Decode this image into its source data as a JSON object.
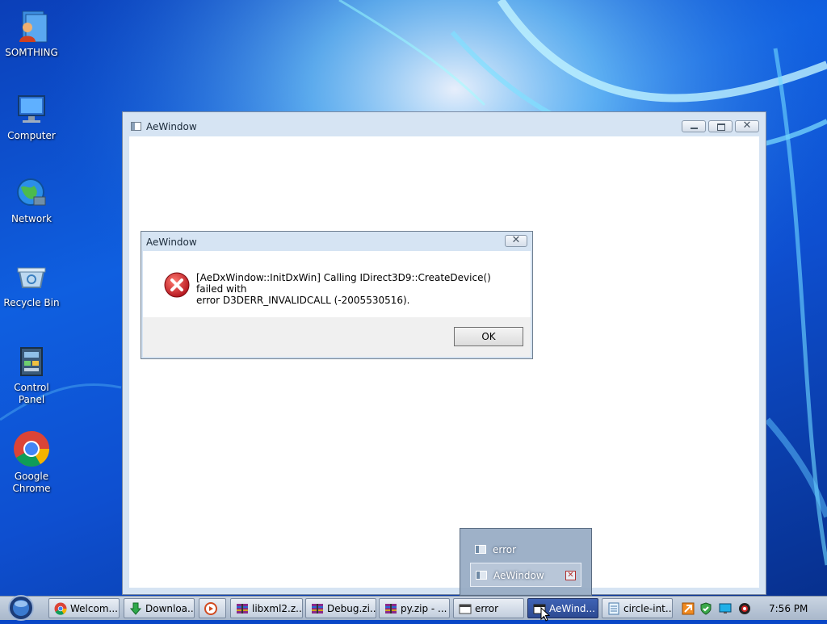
{
  "desktop": {
    "icons": [
      {
        "label": "SOMTHING",
        "icon": "user-folder-icon"
      },
      {
        "label": "Computer",
        "icon": "computer-icon"
      },
      {
        "label": "Network",
        "icon": "network-globe-icon"
      },
      {
        "label": "Recycle Bin",
        "icon": "recycle-bin-icon"
      },
      {
        "label": "Control Panel",
        "icon": "control-panel-icon"
      },
      {
        "label": "Google Chrome",
        "icon": "chrome-icon"
      }
    ]
  },
  "main_window": {
    "title": "AeWindow",
    "buttons": {
      "minimize": "minimize",
      "maximize": "maximize",
      "close": "✕"
    }
  },
  "dialog": {
    "title": "AeWindow",
    "close_glyph": "✕",
    "icon": "error-icon",
    "message_line1": "[AeDxWindow::InitDxWin] Calling IDirect3D9::CreateDevice() failed with",
    "message_line2": "error D3DERR_INVALIDCALL (-2005530516).",
    "ok_label": "OK"
  },
  "thumbnail_popup": {
    "items": [
      {
        "label": "error",
        "active": false
      },
      {
        "label": "AeWindow",
        "active": true,
        "close_glyph": "✕"
      }
    ]
  },
  "taskbar": {
    "buttons": [
      {
        "label": "Welcom...",
        "icon": "chrome-icon"
      },
      {
        "label": "Downloa...",
        "icon": "download-arrow-icon"
      },
      {
        "label": "",
        "icon": "media-player-icon"
      },
      {
        "label": "libxml2.z...",
        "icon": "winrar-archive-icon"
      },
      {
        "label": "Debug.zi...",
        "icon": "winrar-archive-icon"
      },
      {
        "label": "py.zip - ...",
        "icon": "winrar-archive-icon"
      },
      {
        "label": "error",
        "icon": "console-window-icon"
      },
      {
        "label": "AeWind...",
        "icon": "console-window-icon",
        "active": true
      },
      {
        "label": "circle-int...",
        "icon": "notepad-icon"
      }
    ],
    "clock": "7:56 PM"
  },
  "colors": {
    "taskbar_active": "#2d4a92",
    "error_red": "#c4202a",
    "wallpaper_blue": "#0f5fe0"
  }
}
